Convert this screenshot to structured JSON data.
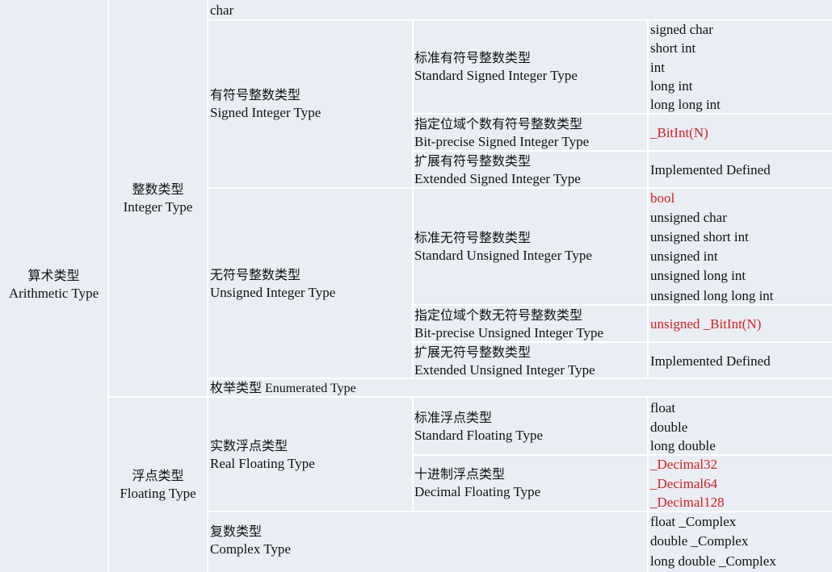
{
  "root": {
    "zh": "算术类型",
    "en": "Arithmetic Type"
  },
  "integer": {
    "zh": "整数类型",
    "en": "Integer Type",
    "char": "char",
    "signed": {
      "zh": "有符号整数类型",
      "en": "Signed Integer Type",
      "standard": {
        "zh": "标准有符号整数类型",
        "en": "Standard Signed Integer Type",
        "types": [
          "signed char",
          "short int",
          "int",
          "long int",
          "long long int"
        ]
      },
      "bitprecise": {
        "zh": "指定位域个数有符号整数类型",
        "en": "Bit-precise Signed Integer Type",
        "type": "_BitInt(N)"
      },
      "extended": {
        "zh": "扩展有符号整数类型",
        "en": "Extended Signed Integer Type",
        "type": "Implemented Defined"
      }
    },
    "unsigned": {
      "zh": "无符号整数类型",
      "en": "Unsigned Integer Type",
      "standard": {
        "zh": "标准无符号整数类型",
        "en": "Standard Unsigned Integer Type",
        "types": [
          "bool",
          "unsigned char",
          "unsigned short int",
          "unsigned int",
          "unsigned long int",
          "unsigned long long int"
        ]
      },
      "bitprecise": {
        "zh": "指定位域个数无符号整数类型",
        "en": "Bit-precise Unsigned Integer Type",
        "type": "unsigned _BitInt(N)"
      },
      "extended": {
        "zh": "扩展无符号整数类型",
        "en": "Extended Unsigned Integer Type",
        "type": "Implemented Defined"
      }
    },
    "enumerated": "枚举类型 Enumerated Type"
  },
  "floating": {
    "zh": "浮点类型",
    "en": "Floating Type",
    "real": {
      "zh": "实数浮点类型",
      "en": "Real Floating Type",
      "standard": {
        "zh": "标准浮点类型",
        "en": "Standard Floating Type",
        "types": [
          "float",
          "double",
          "long double"
        ]
      },
      "decimal": {
        "zh": "十进制浮点类型",
        "en": "Decimal Floating Type",
        "types": [
          "_Decimal32",
          "_Decimal64",
          "_Decimal128"
        ]
      }
    },
    "complex": {
      "zh": "复数类型",
      "en": "Complex Type",
      "types": [
        "float _Complex",
        "double _Complex",
        "long double _Complex"
      ]
    }
  },
  "colors": {
    "cell": "#e9edf4",
    "border": "#ffffff",
    "highlight": "#d81e1e"
  }
}
